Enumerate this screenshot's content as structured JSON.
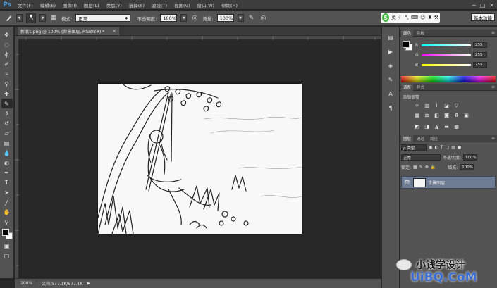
{
  "app": {
    "logo": "Ps",
    "window_controls": [
      "─",
      "□",
      "✕"
    ]
  },
  "menu": [
    "文件(F)",
    "编辑(E)",
    "图像(I)",
    "图层(L)",
    "类型(Y)",
    "选择(S)",
    "滤镜(T)",
    "视图(V)",
    "窗口(W)",
    "帮助(H)"
  ],
  "options": {
    "brush_size": "13",
    "mode_label": "模式:",
    "mode_value": "正常",
    "opacity_label": "不透明度:",
    "opacity_value": "100%",
    "flow_label": "流量:",
    "flow_value": "100%"
  },
  "ime": {
    "logo": "S",
    "label": "英"
  },
  "workspace": "基本功能",
  "document": {
    "tab_title": "新浪1.png @ 100% (背景图层, RGB/8#) *",
    "close": "×"
  },
  "status": {
    "zoom": "100%",
    "doc_size": "文档:577.1K/577.1K"
  },
  "color_panel": {
    "tabs": [
      "颜色",
      "色板"
    ],
    "channels": [
      {
        "label": "R",
        "value": "255",
        "gradient": "linear-gradient(90deg,#00ffff,#ffffff)"
      },
      {
        "label": "G",
        "value": "255",
        "gradient": "linear-gradient(90deg,#ff00ff,#ffffff)"
      },
      {
        "label": "B",
        "value": "255",
        "gradient": "linear-gradient(90deg,#ffff00,#ffffff)"
      }
    ]
  },
  "adjust_panel": {
    "tabs": [
      "调整",
      "样式"
    ],
    "title": "添加调整"
  },
  "layers_panel": {
    "tabs": [
      "图层",
      "通道",
      "路径"
    ],
    "kind_label": "ρ 类型",
    "blend_mode": "正常",
    "opacity_label": "不透明度:",
    "opacity_value": "100%",
    "lock_label": "锁定:",
    "fill_label": "填充:",
    "fill_value": "100%",
    "layer_name": "背景图层"
  },
  "watermark": {
    "text": "小钱学设计",
    "brand": "UiBQ.CoM"
  },
  "colors": {
    "bg": "#282828",
    "panel": "#535353",
    "accent": "#4a9fe0",
    "layer_selected": "#6d7b93"
  }
}
